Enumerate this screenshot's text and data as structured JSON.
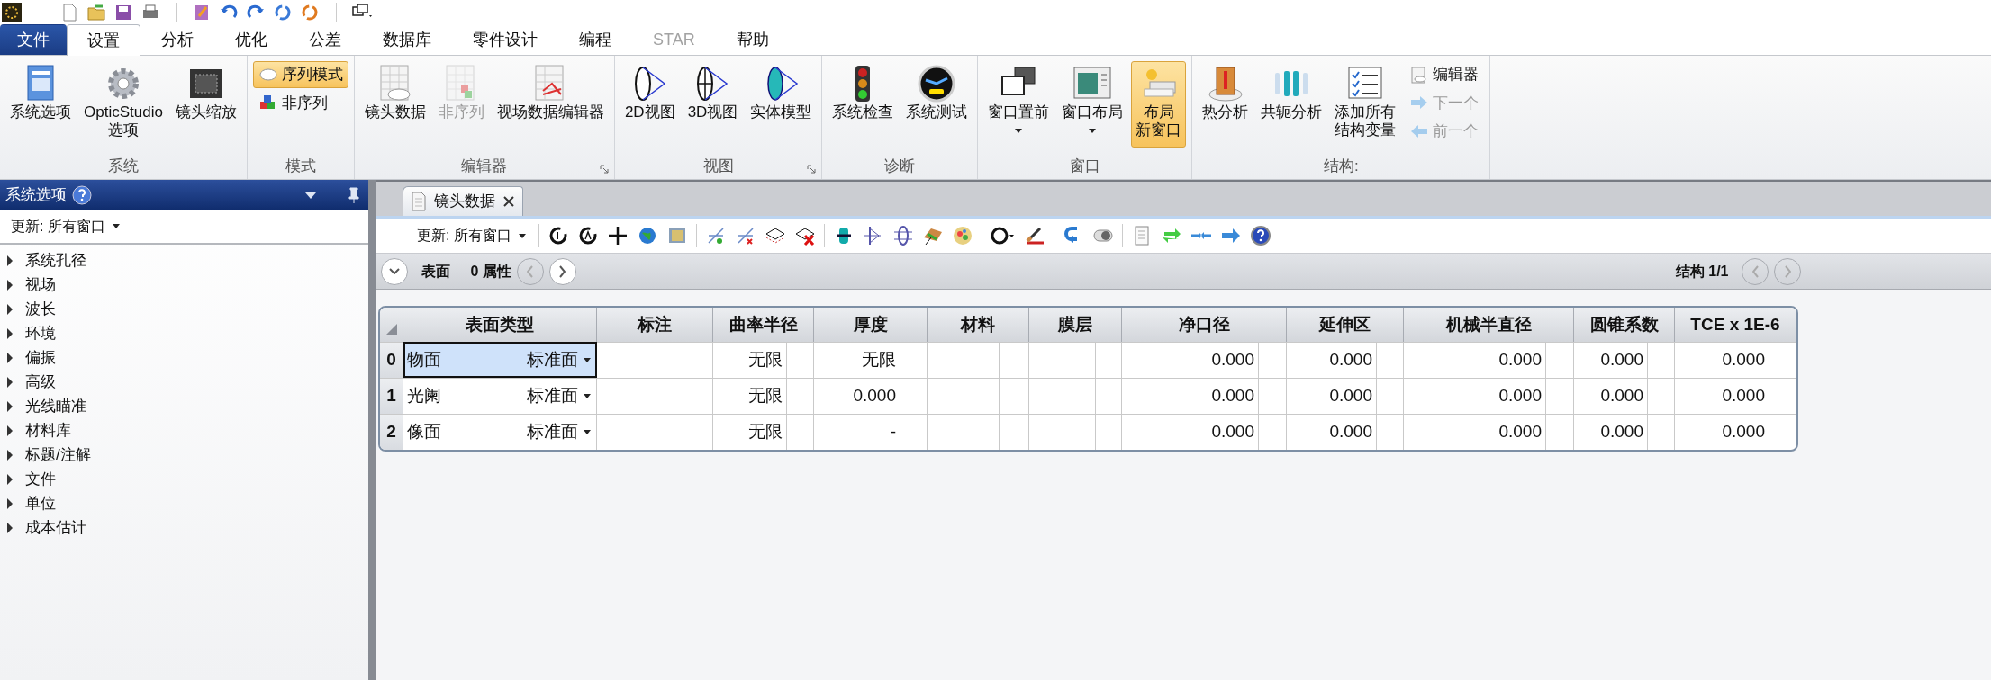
{
  "menu_tabs": [
    {
      "label": "文件",
      "kind": "file",
      "selected": false,
      "disabled": false
    },
    {
      "label": "设置",
      "kind": "tab",
      "selected": true,
      "disabled": false
    },
    {
      "label": "分析",
      "kind": "tab",
      "selected": false,
      "disabled": false
    },
    {
      "label": "优化",
      "kind": "tab",
      "selected": false,
      "disabled": false
    },
    {
      "label": "公差",
      "kind": "tab",
      "selected": false,
      "disabled": false
    },
    {
      "label": "数据库",
      "kind": "tab",
      "selected": false,
      "disabled": false
    },
    {
      "label": "零件设计",
      "kind": "tab",
      "selected": false,
      "disabled": false
    },
    {
      "label": "编程",
      "kind": "tab",
      "selected": false,
      "disabled": false
    },
    {
      "label": "STAR",
      "kind": "tab",
      "selected": false,
      "disabled": true
    },
    {
      "label": "帮助",
      "kind": "tab",
      "selected": false,
      "disabled": false
    }
  ],
  "ribbon": {
    "groups": [
      {
        "label": "系统",
        "launcher": false,
        "items": [
          {
            "label": "系统选项",
            "kind": "large",
            "selected": false,
            "disabled": false,
            "dropdown": false
          },
          {
            "lines": [
              "OpticStudio",
              "选项"
            ],
            "kind": "large",
            "selected": false,
            "disabled": false,
            "dropdown": false
          },
          {
            "label": "镜头缩放",
            "kind": "large",
            "selected": false,
            "disabled": false,
            "dropdown": false
          }
        ]
      },
      {
        "label": "模式",
        "launcher": false,
        "items": [
          {
            "label": "序列模式",
            "kind": "small",
            "selected": true,
            "disabled": false,
            "dropdown": false
          },
          {
            "label": "非序列",
            "kind": "small",
            "selected": false,
            "disabled": false,
            "dropdown": false
          }
        ]
      },
      {
        "label": "编辑器",
        "launcher": true,
        "items": [
          {
            "label": "镜头数据",
            "kind": "large",
            "selected": false,
            "disabled": false,
            "dropdown": false
          },
          {
            "label": "非序列",
            "kind": "large",
            "selected": false,
            "disabled": true,
            "dropdown": false
          },
          {
            "label": "视场数据编辑器",
            "kind": "large",
            "selected": false,
            "disabled": false,
            "dropdown": false
          }
        ]
      },
      {
        "label": "视图",
        "launcher": true,
        "items": [
          {
            "label": "2D视图",
            "kind": "large",
            "selected": false,
            "disabled": false,
            "dropdown": false
          },
          {
            "label": "3D视图",
            "kind": "large",
            "selected": false,
            "disabled": false,
            "dropdown": false
          },
          {
            "label": "实体模型",
            "kind": "large",
            "selected": false,
            "disabled": false,
            "dropdown": false
          }
        ]
      },
      {
        "label": "诊断",
        "launcher": false,
        "items": [
          {
            "label": "系统检查",
            "kind": "large",
            "selected": false,
            "disabled": false,
            "dropdown": false
          },
          {
            "label": "系统测试",
            "kind": "large",
            "selected": false,
            "disabled": false,
            "dropdown": false
          }
        ]
      },
      {
        "label": "窗口",
        "launcher": false,
        "items": [
          {
            "label": "窗口置前",
            "kind": "large",
            "selected": false,
            "disabled": false,
            "dropdown": true
          },
          {
            "label": "窗口布局",
            "kind": "large",
            "selected": false,
            "disabled": false,
            "dropdown": true
          },
          {
            "lines": [
              "布局",
              "新窗口"
            ],
            "kind": "large",
            "selected": true,
            "disabled": false,
            "dropdown": false
          }
        ]
      },
      {
        "label": "结构:",
        "launcher": false,
        "items": [
          {
            "label": "热分析",
            "kind": "large",
            "selected": false,
            "disabled": false,
            "dropdown": false
          },
          {
            "label": "共轭分析",
            "kind": "large",
            "selected": false,
            "disabled": false,
            "dropdown": false
          },
          {
            "lines": [
              "添加所有",
              "结构变量"
            ],
            "kind": "large",
            "selected": false,
            "disabled": false,
            "dropdown": false
          },
          {
            "label": "编辑器",
            "kind": "small",
            "selected": false,
            "disabled": false,
            "dropdown": false
          },
          {
            "label": "下一个",
            "kind": "small",
            "selected": false,
            "disabled": true,
            "dropdown": false
          },
          {
            "label": "前一个",
            "kind": "small",
            "selected": false,
            "disabled": true,
            "dropdown": false
          }
        ]
      }
    ]
  },
  "options_panel": {
    "title": "系统选项",
    "update_label": "更新: 所有窗口",
    "items": [
      {
        "label": "系统孔径",
        "expanded": false
      },
      {
        "label": "视场",
        "expanded": false
      },
      {
        "label": "波长",
        "expanded": false
      },
      {
        "label": "环境",
        "expanded": false
      },
      {
        "label": "偏振",
        "expanded": false
      },
      {
        "label": "高级",
        "expanded": false
      },
      {
        "label": "光线瞄准",
        "expanded": false
      },
      {
        "label": "材料库",
        "expanded": false
      },
      {
        "label": "标题/注解",
        "expanded": false
      },
      {
        "label": "文件",
        "expanded": false
      },
      {
        "label": "单位",
        "expanded": false
      },
      {
        "label": "成本估计",
        "expanded": false
      }
    ]
  },
  "editor": {
    "tab": {
      "title": "镜头数据"
    },
    "update_label": "更新: 所有窗口",
    "surface_bar": {
      "surface_label": "表面",
      "properties_label": "0 属性",
      "config_label": "结构 1/1"
    },
    "table": {
      "surface_type_column": "表面类型",
      "columns": [
        "标注",
        "曲率半径",
        "厚度",
        "材料",
        "膜层",
        "净口径",
        "延伸区",
        "机械半直径",
        "圆锥系数",
        "TCE x 1E-6"
      ],
      "rows": [
        {
          "number": "0",
          "comment": "物面",
          "type": "标准面",
          "selected": true,
          "cells": [
            "",
            "无限",
            "无限",
            "",
            "",
            "0.000",
            "0.000",
            "0.000",
            "0.000",
            "0.000"
          ]
        },
        {
          "number": "1",
          "comment": "光阑",
          "type": "标准面",
          "selected": false,
          "cells": [
            "",
            "无限",
            "0.000",
            "",
            "",
            "0.000",
            "0.000",
            "0.000",
            "0.000",
            "0.000"
          ]
        },
        {
          "number": "2",
          "comment": "像面",
          "type": "标准面",
          "selected": false,
          "cells": [
            "",
            "无限",
            "-",
            "",
            "",
            "0.000",
            "0.000",
            "0.000",
            "0.000",
            "0.000"
          ]
        }
      ]
    }
  }
}
